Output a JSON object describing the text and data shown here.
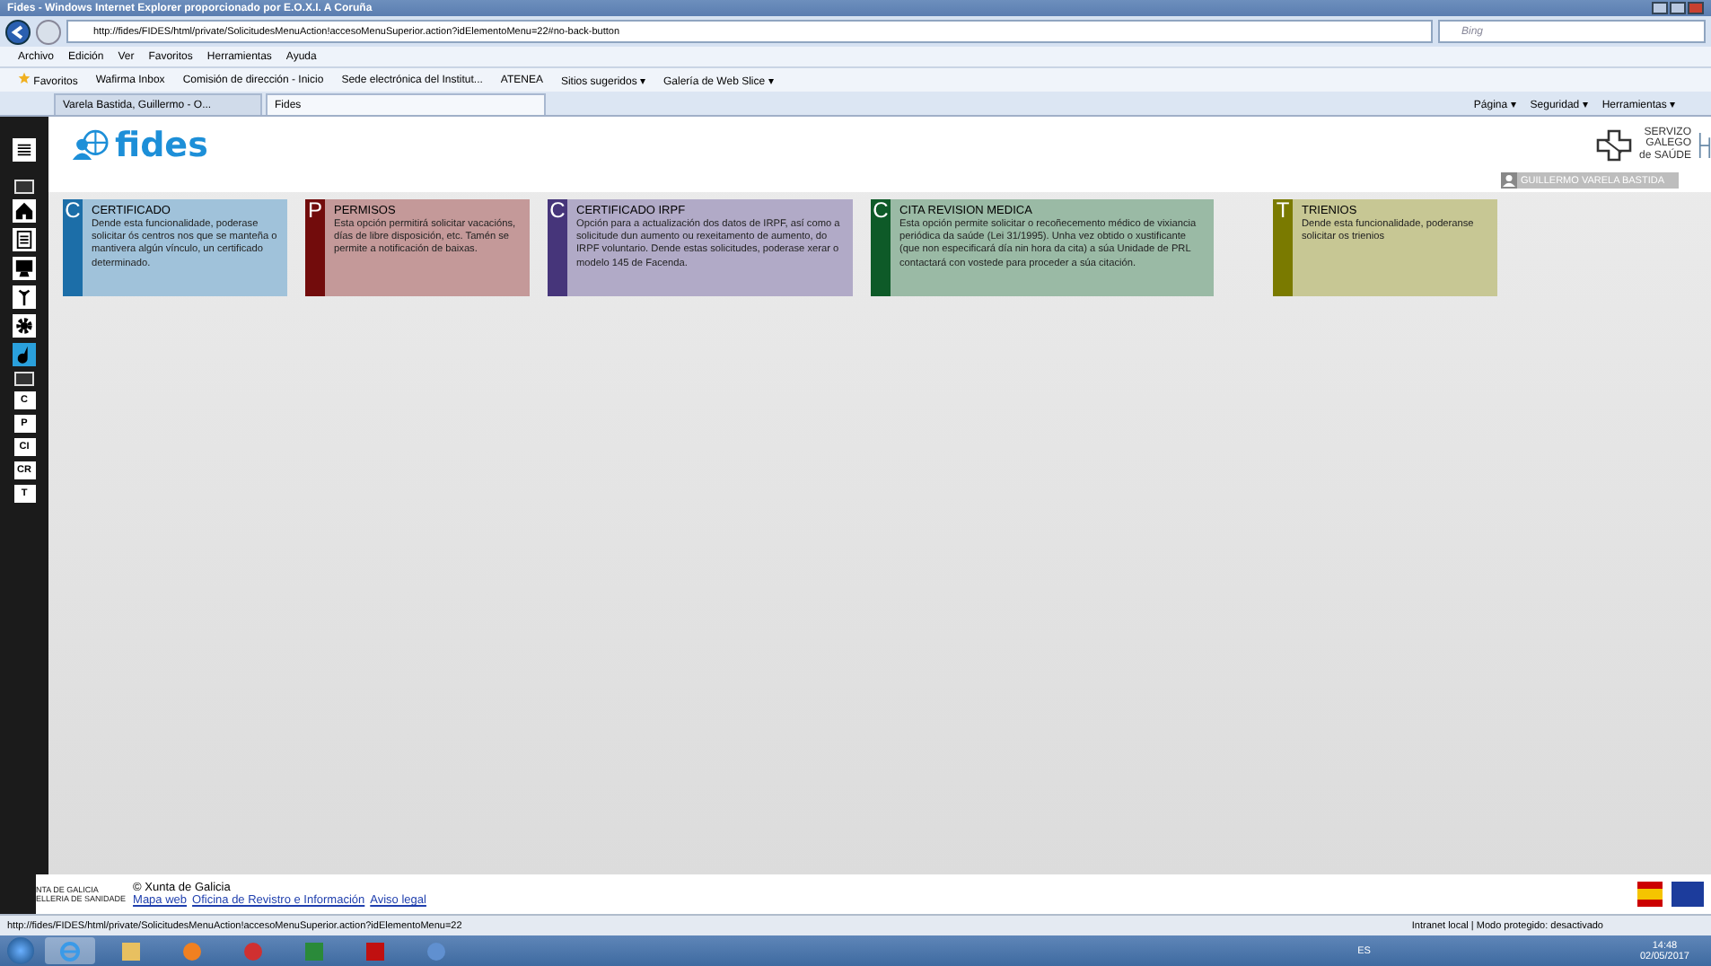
{
  "window": {
    "title": "Fides - Windows Internet Explorer proporcionado por E.O.X.I. A Coruña"
  },
  "address_bar": {
    "url": "http://fides/FIDES/html/private/SolicitudesMenuAction!accesoMenuSuperior.action?idElementoMenu=22#no-back-button",
    "search_placeholder": "Bing"
  },
  "menu_bar": [
    "Archivo",
    "Edición",
    "Ver",
    "Favoritos",
    "Herramientas",
    "Ayuda"
  ],
  "favorites_bar": {
    "label": "Favoritos",
    "items": [
      {
        "label": "Wafirma Inbox"
      },
      {
        "label": "Comisión de dirección - Inicio"
      },
      {
        "label": "Sede electrónica del Institut..."
      },
      {
        "label": "ATENEA"
      },
      {
        "label": "Sitios sugeridos ▾"
      },
      {
        "label": "Galería de Web Slice ▾"
      }
    ]
  },
  "tabs": [
    {
      "label": "Varela Bastida, Guillermo - O...",
      "selected": false
    },
    {
      "label": "Fides",
      "selected": true
    }
  ],
  "command_bar": [
    "Página ▾",
    "Seguridad ▾",
    "Herramientas ▾"
  ],
  "page": {
    "logo": "fides",
    "brand": [
      "SERVIZO",
      "GALEGO",
      "de SAÚDE"
    ],
    "user": "GUILLERMO VARELA BASTIDA",
    "sidebar": {
      "icons": [
        {
          "kind": "home",
          "selected": false
        },
        {
          "kind": "document",
          "selected": false
        },
        {
          "kind": "monitor",
          "selected": false
        },
        {
          "kind": "antenna",
          "selected": false
        },
        {
          "kind": "gear",
          "selected": false
        },
        {
          "kind": "ink",
          "selected": true
        }
      ],
      "shortcuts": [
        "C",
        "P",
        "CI",
        "CR",
        "T"
      ]
    },
    "cards": [
      {
        "letter": "C",
        "title": "CERTIFICADO",
        "text": "Dende esta funcionalidade, poderase solicitar ós centros nos que se manteña o mantivera algún vínculo, un certificado determinado.",
        "color": "#1c6ea8"
      },
      {
        "letter": "P",
        "title": "PERMISOS",
        "text": "Esta opción permitirá solicitar vacacións, días de libre disposición, etc. Tamén se permite a notificación de baixas.",
        "color": "#720c0c"
      },
      {
        "letter": "C",
        "title": "CERTIFICADO IRPF",
        "text": "Opción para a actualización dos datos de IRPF, así como a solicitude dun aumento ou rexeitamento de aumento, do IRPF voluntario. Dende estas solicitudes, poderase xerar o modelo 145 de Facenda.",
        "color": "#46357a"
      },
      {
        "letter": "C",
        "title": "CITA REVISION MEDICA",
        "text": "Esta opción permite solicitar o recoñecemento médico de vixiancia periódica da saúde (Lei 31/1995). Unha vez obtido o xustificante (que non especificará día nin hora da cita) a súa Unidade de PRL contactará con vostede para proceder a súa citación.",
        "color": "#0e5a28"
      },
      {
        "letter": "T",
        "title": "TRIENIOS",
        "text": "Dende esta funcionalidade, poderanse solicitar os trienios",
        "color": "#7a7a00"
      }
    ],
    "footer": {
      "org": [
        "NTA DE GALICIA",
        "ELLERIA DE SANIDADE"
      ],
      "copyright": "© Xunta de Galicia",
      "links": [
        "Mapa web",
        "Oficina de Revistro e Información",
        "Aviso legal"
      ]
    }
  },
  "status_bar": {
    "url": "http://fides/FIDES/html/private/SolicitudesMenuAction!accesoMenuSuperior.action?idElementoMenu=22",
    "zone": "Intranet local | Modo protegido: desactivado"
  },
  "taskbar": {
    "language": "ES",
    "time": "14:48",
    "date": "02/05/2017"
  }
}
